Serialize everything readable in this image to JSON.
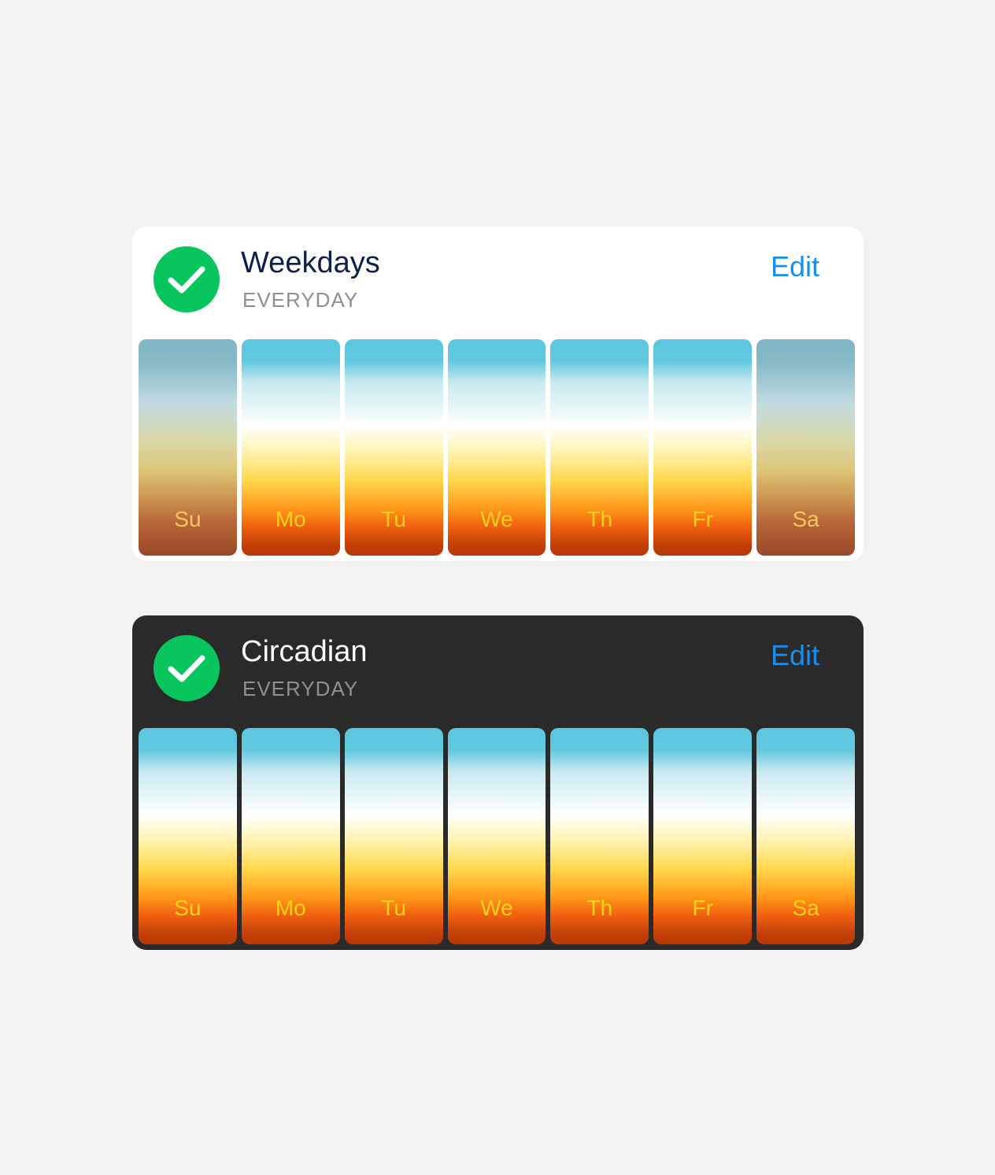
{
  "colors": {
    "page_background": "#f2f2f2",
    "check_green": "#08c65d",
    "edit_blue": "#1590f2",
    "dark_card": "#2b2a2b",
    "day_label": "#ffd21c"
  },
  "schedules": [
    {
      "theme": "light",
      "title": "Weekdays",
      "subtitle": "EVERYDAY",
      "edit_label": "Edit",
      "check_icon": "checkmark-icon",
      "days": [
        {
          "label": "Su",
          "active": false
        },
        {
          "label": "Mo",
          "active": true
        },
        {
          "label": "Tu",
          "active": true
        },
        {
          "label": "We",
          "active": true
        },
        {
          "label": "Th",
          "active": true
        },
        {
          "label": "Fr",
          "active": true
        },
        {
          "label": "Sa",
          "active": false
        }
      ]
    },
    {
      "theme": "dark",
      "title": "Circadian",
      "subtitle": "EVERYDAY",
      "edit_label": "Edit",
      "check_icon": "checkmark-icon",
      "days": [
        {
          "label": "Su",
          "active": true
        },
        {
          "label": "Mo",
          "active": true
        },
        {
          "label": "Tu",
          "active": true
        },
        {
          "label": "We",
          "active": true
        },
        {
          "label": "Th",
          "active": true
        },
        {
          "label": "Fr",
          "active": true
        },
        {
          "label": "Sa",
          "active": true
        }
      ]
    }
  ]
}
